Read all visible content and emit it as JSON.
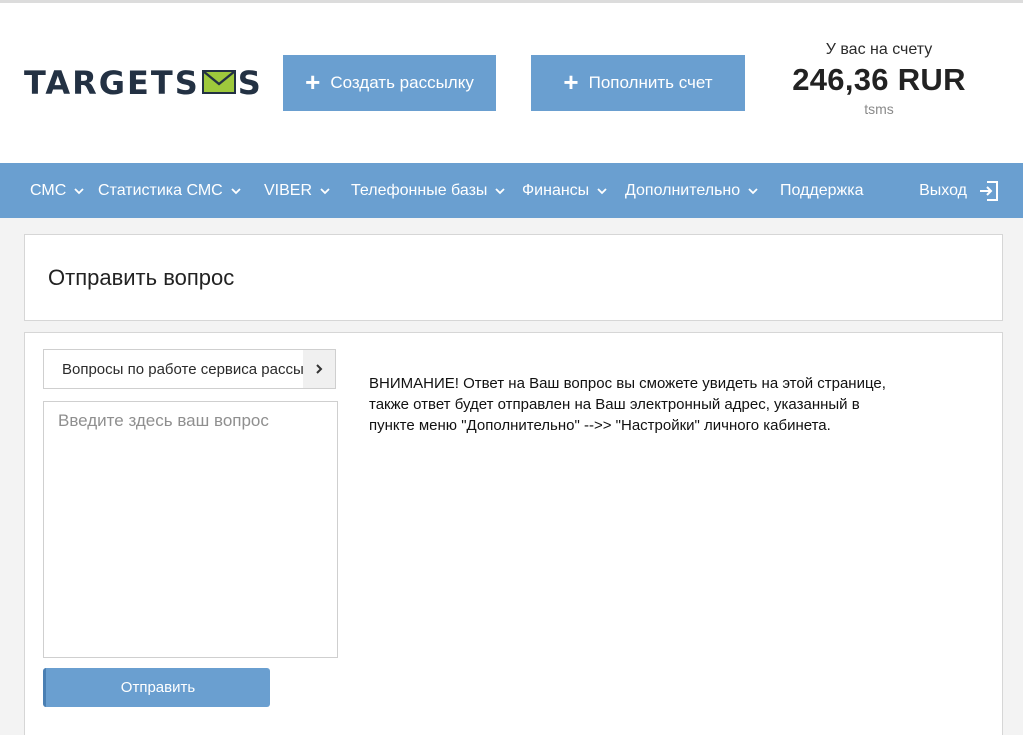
{
  "brand": {
    "logo_left": "TARGET",
    "logo_right": "S",
    "logo_end": "S"
  },
  "header": {
    "create_label": "Создать рассылку",
    "topup_label": "Пополнить счет",
    "balance_label": "У вас на счету",
    "balance_amount": "246,36 RUR",
    "login": "tsms"
  },
  "nav": {
    "items": [
      {
        "label": "СМС"
      },
      {
        "label": "Статистика СМС"
      },
      {
        "label": "VIBER"
      },
      {
        "label": "Телефонные базы"
      },
      {
        "label": "Финансы"
      },
      {
        "label": "Дополнительно"
      },
      {
        "label": "Поддержка"
      }
    ],
    "logout_label": "Выход"
  },
  "page": {
    "title": "Отправить вопрос"
  },
  "form": {
    "topic_value": "Вопросы по работе сервиса рассылок",
    "question_placeholder": "Введите здесь ваш вопрос",
    "question_value": "",
    "submit_label": "Отправить"
  },
  "notice": {
    "line1": "ВНИМАНИЕ! Ответ на Ваш вопрос вы сможете увидеть на этой странице,",
    "line2": "также ответ будет отправлен на Ваш электронный адрес, указанный в",
    "line3": "пункте меню \"Дополнительно\" -->> \"Настройки\" личного кабинета."
  },
  "colors": {
    "accent": "#6a9fd0",
    "logo_dark": "#233143",
    "logo_envelope": "#9ec93c"
  }
}
